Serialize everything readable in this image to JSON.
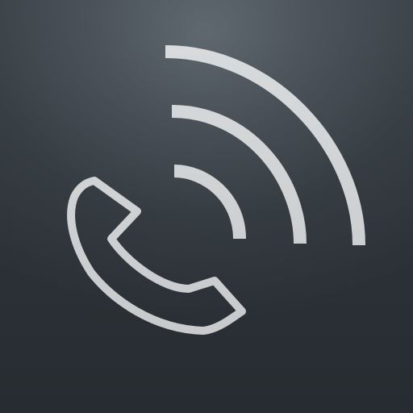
{
  "app_icon": {
    "icon": "phone-call-signal-icon",
    "colors": {
      "background_light": "#5a636b",
      "background_dark": "#2b3137",
      "glyph": "#d9dcde"
    }
  }
}
